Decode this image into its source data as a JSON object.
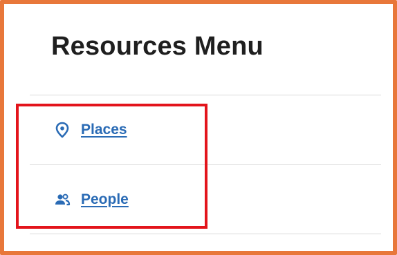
{
  "panel": {
    "title": "Resources Menu"
  },
  "menu": {
    "items": [
      {
        "label": "Places",
        "icon": "map-pin-icon"
      },
      {
        "label": "People",
        "icon": "people-icon"
      }
    ]
  },
  "colors": {
    "frame_border": "#e8773a",
    "link": "#2a6bb5",
    "highlight_border": "#e3141b",
    "divider": "#d9d9d9",
    "title": "#1f1f1f"
  }
}
